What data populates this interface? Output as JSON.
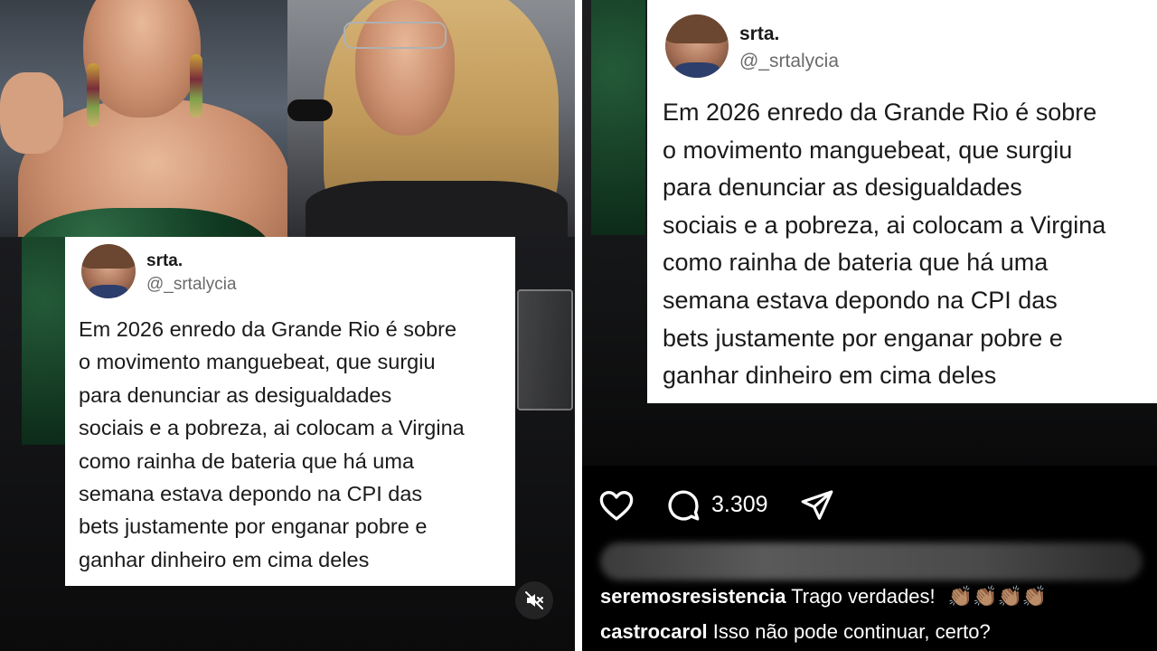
{
  "left": {
    "tweet": {
      "name": "srta.",
      "handle": "@_srtalycia",
      "body": "Em 2026 enredo da Grande Rio é sobre\no movimento manguebeat, que surgiu\npara denunciar as desigualdades\nsociais e a pobreza, ai colocam a Virgina\ncomo rainha de bateria que há uma\nsemana estava depondo na CPI das\nbets justamente por enganar pobre e\nganhar dinheiro em cima deles"
    },
    "mute_icon": "speaker-muted-icon"
  },
  "right": {
    "tweet": {
      "name": "srta.",
      "handle": "@_srtalycia",
      "body": "Em 2026 enredo da Grande Rio é sobre\no movimento manguebeat, que surgiu\npara denunciar as desigualdades\nsociais e a pobreza, ai colocam a Virgina\ncomo rainha de bateria que há uma\nsemana estava depondo na CPI das\nbets justamente por enganar pobre e\nganhar dinheiro em cima deles"
    },
    "actions": {
      "like_icon": "heart-icon",
      "comment_icon": "comment-icon",
      "comment_count": "3.309",
      "share_icon": "send-icon"
    },
    "comments": [
      {
        "user": "seremosresistencia",
        "text": "Trago verdades!",
        "emoji": "👏🏽👏🏽👏🏽👏🏽"
      },
      {
        "user": "castrocarol",
        "text": "Isso não pode continuar, certo?"
      }
    ]
  }
}
